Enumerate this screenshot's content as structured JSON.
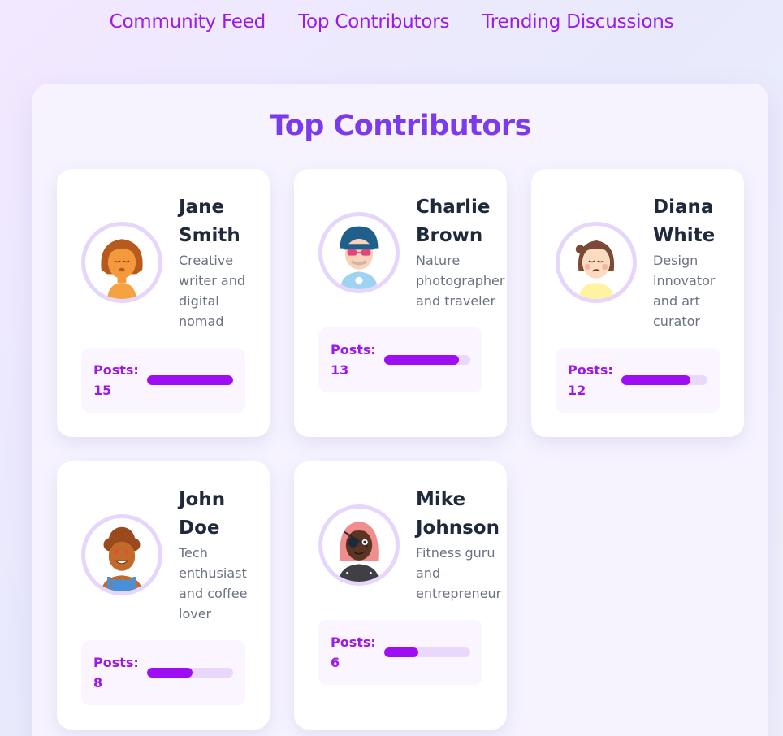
{
  "nav": {
    "items": [
      "Community Feed",
      "Top Contributors",
      "Trending Discussions"
    ]
  },
  "section": {
    "title": "Top Contributors"
  },
  "posts_label": "Posts:",
  "contributors": [
    {
      "name": "Jane Smith",
      "bio": "Creative writer and digital nomad",
      "posts": "15",
      "progress": 1.0,
      "avatar_icon": "woman-brown-hair-avatar-icon"
    },
    {
      "name": "Charlie Brown",
      "bio": "Nature photographer and traveler",
      "posts": "13",
      "progress": 0.87,
      "avatar_icon": "person-beanie-sunglasses-avatar-icon"
    },
    {
      "name": "Diana White",
      "bio": "Design innovator and art curator",
      "posts": "12",
      "progress": 0.8,
      "avatar_icon": "woman-bun-avatar-icon"
    },
    {
      "name": "John Doe",
      "bio": "Tech enthusiast and coffee lover",
      "posts": "8",
      "progress": 0.53,
      "avatar_icon": "man-heart-eyes-avatar-icon"
    },
    {
      "name": "Mike Johnson",
      "bio": "Fitness guru and entrepreneur",
      "posts": "6",
      "progress": 0.4,
      "avatar_icon": "person-eyepatch-avatar-icon"
    }
  ],
  "colors": {
    "accent": "#9b19e9",
    "title": "#7c3aed",
    "bar_fill": "#9d0ef3",
    "bar_track": "#ead7fc"
  }
}
